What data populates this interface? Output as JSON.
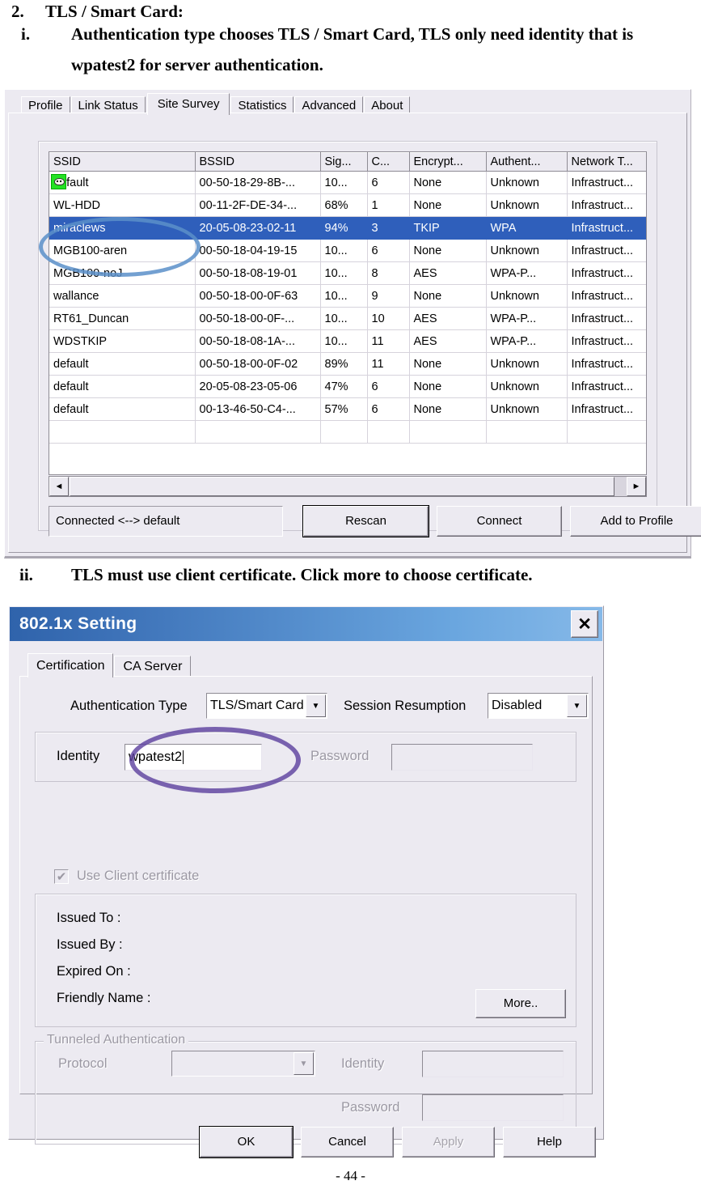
{
  "document": {
    "item_number": "2.",
    "item_title": "TLS / Smart Card:",
    "sub_i_number": "i.",
    "sub_i_line1": "Authentication type chooses TLS / Smart Card, TLS only need identity that is",
    "sub_i_line2": "wpatest2 for server authentication.",
    "sub_ii_number": "ii.",
    "sub_ii_line1": "TLS must use client certificate. Click more to choose certificate.",
    "page_footer": "- 44 -"
  },
  "site_survey": {
    "tabs": [
      {
        "label": "Profile",
        "active": false
      },
      {
        "label": "Link Status",
        "active": false
      },
      {
        "label": "Site Survey",
        "active": true
      },
      {
        "label": "Statistics",
        "active": false
      },
      {
        "label": "Advanced",
        "active": false
      },
      {
        "label": "About",
        "active": false
      }
    ],
    "columns": [
      "SSID",
      "BSSID",
      "Sig...",
      "C...",
      "Encrypt...",
      "Authent...",
      "Network T..."
    ],
    "rows": [
      {
        "ssid": "default",
        "bssid": "00-50-18-29-8B-...",
        "signal": "10...",
        "channel": "6",
        "encryption": "None",
        "authentication": "Unknown",
        "network_type": "Infrastruct...",
        "selected": false,
        "icon": true
      },
      {
        "ssid": "WL-HDD",
        "bssid": "00-11-2F-DE-34-...",
        "signal": "68%",
        "channel": "1",
        "encryption": "None",
        "authentication": "Unknown",
        "network_type": "Infrastruct...",
        "selected": false,
        "icon": false
      },
      {
        "ssid": "miraclews",
        "bssid": "20-05-08-23-02-11",
        "signal": "94%",
        "channel": "3",
        "encryption": "TKIP",
        "authentication": "WPA",
        "network_type": "Infrastruct...",
        "selected": true,
        "icon": false
      },
      {
        "ssid": "MGB100-aren",
        "bssid": "00-50-18-04-19-15",
        "signal": "10...",
        "channel": "6",
        "encryption": "None",
        "authentication": "Unknown",
        "network_type": "Infrastruct...",
        "selected": false,
        "icon": false
      },
      {
        "ssid": "MGB100-noJ",
        "bssid": "00-50-18-08-19-01",
        "signal": "10...",
        "channel": "8",
        "encryption": "AES",
        "authentication": "WPA-P...",
        "network_type": "Infrastruct...",
        "selected": false,
        "icon": false
      },
      {
        "ssid": "wallance",
        "bssid": "00-50-18-00-0F-63",
        "signal": "10...",
        "channel": "9",
        "encryption": "None",
        "authentication": "Unknown",
        "network_type": "Infrastruct...",
        "selected": false,
        "icon": false
      },
      {
        "ssid": "RT61_Duncan",
        "bssid": "00-50-18-00-0F-...",
        "signal": "10...",
        "channel": "10",
        "encryption": "AES",
        "authentication": "WPA-P...",
        "network_type": "Infrastruct...",
        "selected": false,
        "icon": false
      },
      {
        "ssid": "WDSTKIP",
        "bssid": "00-50-18-08-1A-...",
        "signal": "10...",
        "channel": "11",
        "encryption": "AES",
        "authentication": "WPA-P...",
        "network_type": "Infrastruct...",
        "selected": false,
        "icon": false
      },
      {
        "ssid": "default",
        "bssid": "00-50-18-00-0F-02",
        "signal": "89%",
        "channel": "11",
        "encryption": "None",
        "authentication": "Unknown",
        "network_type": "Infrastruct...",
        "selected": false,
        "icon": false
      },
      {
        "ssid": "default",
        "bssid": "20-05-08-23-05-06",
        "signal": "47%",
        "channel": "6",
        "encryption": "None",
        "authentication": "Unknown",
        "network_type": "Infrastruct...",
        "selected": false,
        "icon": false
      },
      {
        "ssid": "default",
        "bssid": "00-13-46-50-C4-...",
        "signal": "57%",
        "channel": "6",
        "encryption": "None",
        "authentication": "Unknown",
        "network_type": "Infrastruct...",
        "selected": false,
        "icon": false
      },
      {
        "ssid": "",
        "bssid": "",
        "signal": "",
        "channel": "",
        "encryption": "",
        "authentication": "",
        "network_type": "",
        "selected": false,
        "icon": false
      }
    ],
    "scroll_left_arrow": "◄",
    "scroll_right_arrow": "►",
    "status_text": "Connected <--> default",
    "buttons": {
      "rescan": "Rescan",
      "connect": "Connect",
      "add_to_profile": "Add to Profile"
    }
  },
  "dot1x_dialog": {
    "title": "802.1x Setting",
    "close_label": "✕",
    "tabs": [
      {
        "label": "Certification",
        "active": true
      },
      {
        "label": "CA Server",
        "active": false
      }
    ],
    "auth_type_label": "Authentication Type",
    "auth_type_value": "TLS/Smart Card",
    "session_resumption_label": "Session Resumption",
    "session_resumption_value": "Disabled",
    "identity_label": "Identity",
    "identity_value": "wpatest2",
    "password_label": "Password",
    "password_value": "",
    "use_client_cert_label": "Use Client certificate",
    "use_client_cert_checked": "✔",
    "cert_fields": [
      "Issued To :",
      "Issued By :",
      "Expired On :",
      "Friendly Name :"
    ],
    "more_button": "More..",
    "tunneled": {
      "legend": "Tunneled Authentication",
      "protocol_label": "Protocol",
      "protocol_value": "",
      "identity_label": "Identity",
      "identity_value": "",
      "password_label": "Password",
      "password_value": ""
    },
    "buttons": {
      "ok": "OK",
      "cancel": "Cancel",
      "apply": "Apply",
      "help": "Help"
    },
    "arrow_glyph": "▼"
  },
  "colors": {
    "selection_blue": "#2f5fbb",
    "titlebar_dark": "#2f63ab",
    "titlebar_light": "#86b9e8",
    "annotation_blue": "#5b8fc9",
    "annotation_purple": "#5b3f9e",
    "dialog_face": "#eceaf1"
  }
}
